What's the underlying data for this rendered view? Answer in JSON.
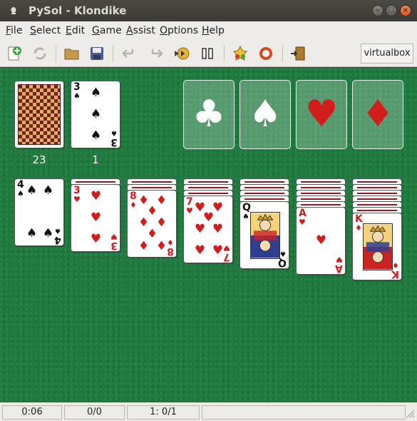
{
  "window": {
    "title": "PySol - Klondike"
  },
  "menu": [
    {
      "label": "File",
      "key": "F"
    },
    {
      "label": "Select",
      "key": "S"
    },
    {
      "label": "Edit",
      "key": "E"
    },
    {
      "label": "Game",
      "key": "G"
    },
    {
      "label": "Assist",
      "key": "A"
    },
    {
      "label": "Options",
      "key": "O"
    },
    {
      "label": "Help",
      "key": "H"
    }
  ],
  "toolbar": {
    "player": "virtualbox",
    "buttons": [
      "new-game-icon",
      "restart-icon",
      "open-icon",
      "save-icon",
      "undo-icon",
      "redo-icon",
      "autodrop-icon",
      "pause-icon",
      "statistics-icon",
      "rules-icon",
      "quit-icon"
    ]
  },
  "stock": {
    "count": "23"
  },
  "waste": {
    "count": "1",
    "top_rank": "3",
    "top_suit": "♠"
  },
  "foundations": [
    "♣",
    "♠",
    "♥",
    "♦"
  ],
  "tableau": [
    {
      "rank": "4",
      "suit": "♠",
      "hidden": 0
    },
    {
      "rank": "3",
      "suit": "♥",
      "hidden": 1
    },
    {
      "rank": "8",
      "suit": "♦",
      "hidden": 2
    },
    {
      "rank": "7",
      "suit": "♥",
      "hidden": 3
    },
    {
      "rank": "Q",
      "suit": "♠",
      "hidden": 4
    },
    {
      "rank": "A",
      "suit": "♥",
      "hidden": 5
    },
    {
      "rank": "K",
      "suit": "♦",
      "hidden": 6
    }
  ],
  "status": {
    "time": "0:06",
    "moves": "0/0",
    "progress": "1: 0/1",
    "message": ""
  },
  "colors": {
    "table": "#1e7a3e",
    "red_suit": "#d21d1d",
    "black_suit": "#111111"
  }
}
